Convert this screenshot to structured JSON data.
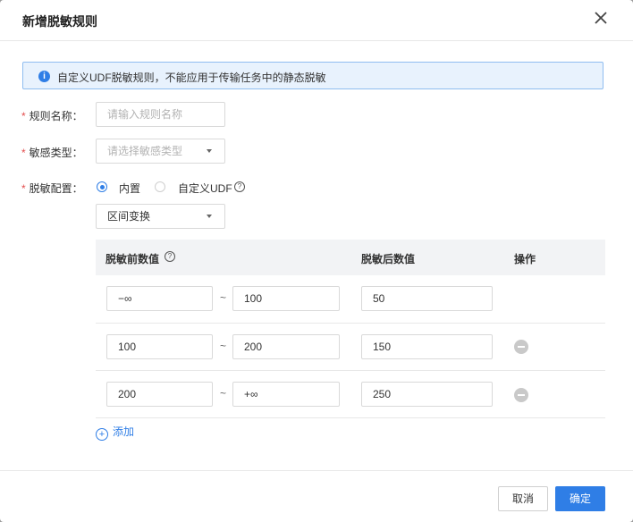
{
  "dialog": {
    "title": "新增脱敏规则",
    "info": "自定义UDF脱敏规则，不能应用于传输任务中的静态脱敏"
  },
  "form": {
    "rule_name": {
      "label": "规则名称：",
      "placeholder": "请输入规则名称"
    },
    "sensitive_type": {
      "label": "敏感类型：",
      "placeholder": "请选择敏感类型"
    },
    "config": {
      "label": "脱敏配置：",
      "options": [
        {
          "label": "内置",
          "selected": true
        },
        {
          "label": "自定义UDF",
          "selected": false
        }
      ],
      "method": "区间变换"
    }
  },
  "table": {
    "headers": {
      "before": "脱敏前数值",
      "after": "脱敏后数值",
      "action": "操作"
    },
    "rows": [
      {
        "from": "−∞",
        "to": "100",
        "value": "50",
        "deletable": false
      },
      {
        "from": "100",
        "to": "200",
        "value": "150",
        "deletable": true
      },
      {
        "from": "200",
        "to": "+∞",
        "value": "250",
        "deletable": true
      }
    ],
    "separator": "~",
    "add_label": "添加"
  },
  "footer": {
    "cancel": "取消",
    "ok": "确定"
  },
  "colors": {
    "accent": "#2f7ee6",
    "required": "#e34d4d",
    "info_bg": "#e8f2fd"
  }
}
